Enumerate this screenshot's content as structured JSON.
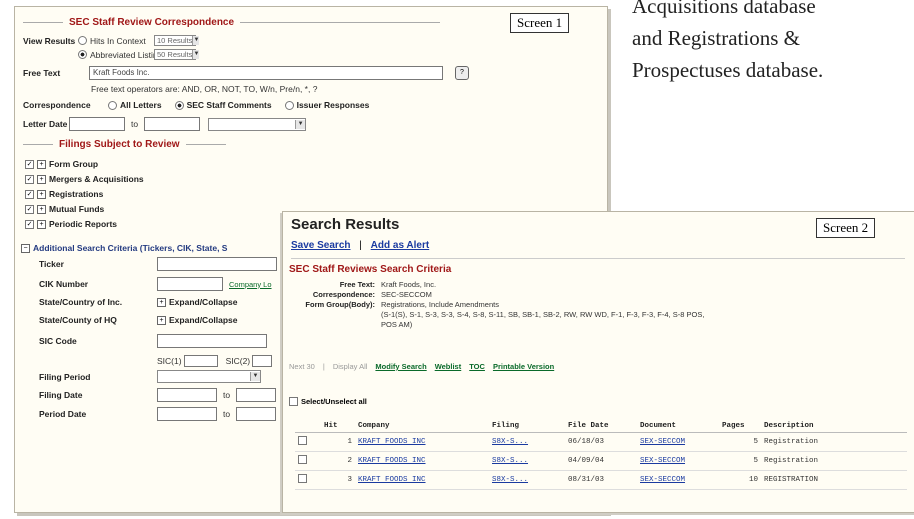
{
  "caption": {
    "line1": "Acquisitions database",
    "line2": "and Registrations &",
    "line3": "Prospectuses database."
  },
  "screen1": {
    "tag": "Screen 1",
    "legend_title": "SEC Staff Review Correspondence",
    "view_results": {
      "label": "View Results",
      "opt1": "Hits In Context",
      "opt1_select": "10 Results",
      "opt2": "Abbreviated Listing",
      "opt2_select": "50 Results"
    },
    "free_text": {
      "label": "Free Text",
      "value": "Kraft Foods Inc.",
      "help": "Free text operators are: AND, OR, NOT, TO, W/n, Pre/n, *, ?"
    },
    "correspondence": {
      "label": "Correspondence",
      "opt1": "All Letters",
      "opt2": "SEC Staff Comments",
      "opt3": "Issuer Responses"
    },
    "letter_date": {
      "label": "Letter Date",
      "to": "to"
    },
    "filings_legend": "Filings Subject to Review",
    "filing_types": [
      "Form Group",
      "Mergers & Acquisitions",
      "Registrations",
      "Mutual Funds",
      "Periodic Reports"
    ],
    "additional": {
      "label": "Additional Search Criteria (Tickers, CIK, State, S",
      "ticker": "Ticker",
      "cik": "CIK Number",
      "company_lookup": "Company Lo",
      "state_inc": "State/Country of Inc.",
      "state_hq": "State/County of HQ",
      "expand": "Expand/Collapse",
      "sic": "SIC Code",
      "sic1": "SIC(1)",
      "sic2": "SIC(2)",
      "filing_period": "Filing Period",
      "filing_date": "Filing Date",
      "period_date": "Period Date",
      "to": "to"
    }
  },
  "screen2": {
    "tag": "Screen 2",
    "title": "Search Results",
    "save_search": "Save Search",
    "divider": "|",
    "add_alert": "Add as Alert",
    "criteria_title": "SEC Staff Reviews Search Criteria",
    "criteria": [
      {
        "k": "Free Text:",
        "v": "Kraft Foods, Inc."
      },
      {
        "k": "Correspondence:",
        "v": "SEC-SECCOM"
      },
      {
        "k": "Form Group(Body):",
        "v": "Registrations, Include Amendments"
      }
    ],
    "criteria_cont1": "(S-1(S), S-1, S-3, S-3, S-4, S-8, S-11, SB, SB-1, SB-2, RW, RW WD, F-1, F-3, F-3, F-4, S-8 POS,",
    "criteria_cont2": "POS AM)",
    "actions": {
      "hits": "Next 30",
      "display_all": "Display All",
      "modify": "Modify Search",
      "weblist": "Weblist",
      "toc": "TOC",
      "printable": "Printable Version"
    },
    "select_all": "Select/Unselect all",
    "columns": [
      "",
      "Hit",
      "Company",
      "Filing",
      "File Date",
      "Document",
      "Pages",
      "Description"
    ],
    "rows": [
      {
        "hit": "1",
        "company": "KRAFT FOODS INC",
        "filing": "S8X-S...",
        "date": "06/18/03",
        "doc": "SEX-SECCOM",
        "pages": "5",
        "desc": "Registration"
      },
      {
        "hit": "2",
        "company": "KRAFT FOODS INC",
        "filing": "S8X-S...",
        "date": "04/09/04",
        "doc": "SEX-SECCOM",
        "pages": "5",
        "desc": "Registration"
      },
      {
        "hit": "3",
        "company": "KRAFT FOODS INC",
        "filing": "S8X-S...",
        "date": "08/31/03",
        "doc": "SEX-SECCOM",
        "pages": "10",
        "desc": "REGISTRATION"
      }
    ]
  }
}
